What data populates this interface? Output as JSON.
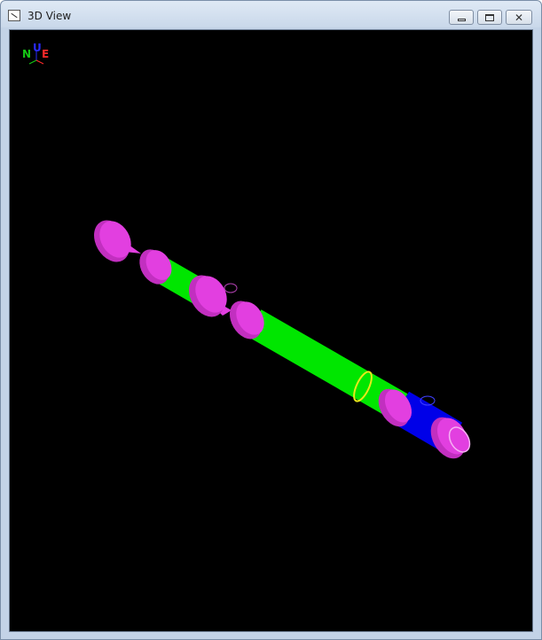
{
  "window": {
    "title": "3D View"
  },
  "controls": {
    "minimize_icon": "minimize-icon",
    "maximize_icon": "restore-icon",
    "close_icon": "close-icon"
  },
  "axis_indicator": {
    "up": "U",
    "north": "N",
    "east": "E",
    "colors": {
      "up": "#2a2aff",
      "north": "#16c916",
      "east": "#ff2a2a"
    }
  },
  "model": {
    "colors": {
      "flange": "#e23fe0",
      "pipe_green": "#00e600",
      "pipe_blue": "#0000e8",
      "hanger": "#e8e81a",
      "background": "#000000"
    }
  }
}
